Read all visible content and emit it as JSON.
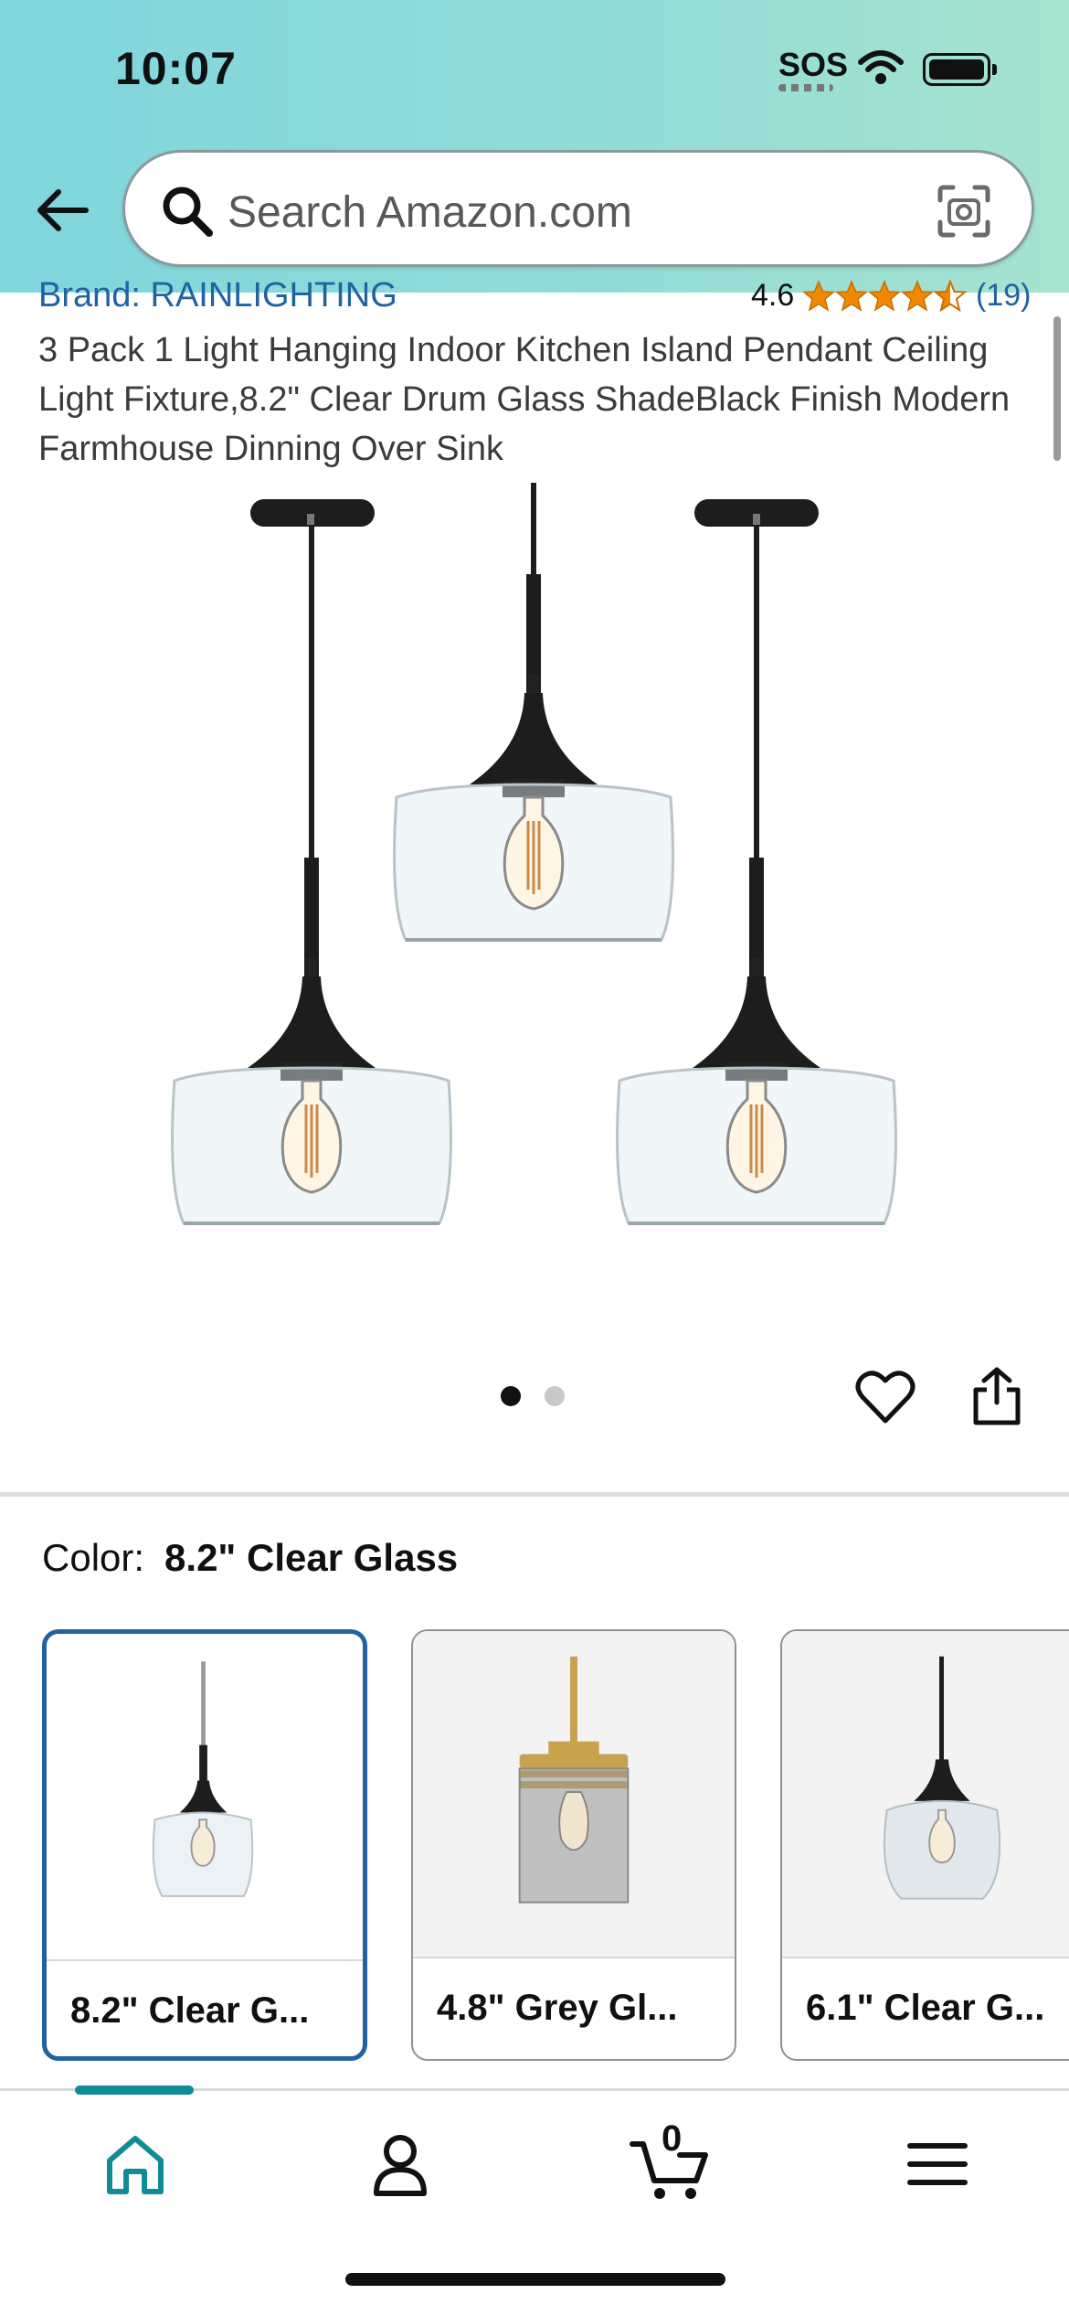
{
  "status_bar": {
    "time": "10:07",
    "sos": "SOS"
  },
  "search": {
    "placeholder": "Search Amazon.com"
  },
  "product": {
    "brand": "Brand: RAINLIGHTING",
    "rating_value": "4.6",
    "rating_stars": 4.5,
    "review_count": "(19)",
    "title": "3 Pack 1 Light Hanging Indoor Kitchen Island Pendant Ceiling Light Fixture,8.2\" Clear Drum Glass ShadeBlack Finish Modern Farmhouse Dinning Over Sink",
    "image_page_active": 1,
    "image_page_total": 2
  },
  "color_selector": {
    "label": "Color:",
    "selected_value": "8.2\" Clear Glass",
    "options": [
      {
        "label": "8.2\" Clear G..."
      },
      {
        "label": "4.8\" Grey Gl..."
      },
      {
        "label": "6.1\" Clear G..."
      }
    ]
  },
  "bottom_nav": {
    "cart_count": "0"
  },
  "colors": {
    "link_blue": "#2162a1",
    "star_orange": "#f08804",
    "accent_teal": "#108c96"
  }
}
